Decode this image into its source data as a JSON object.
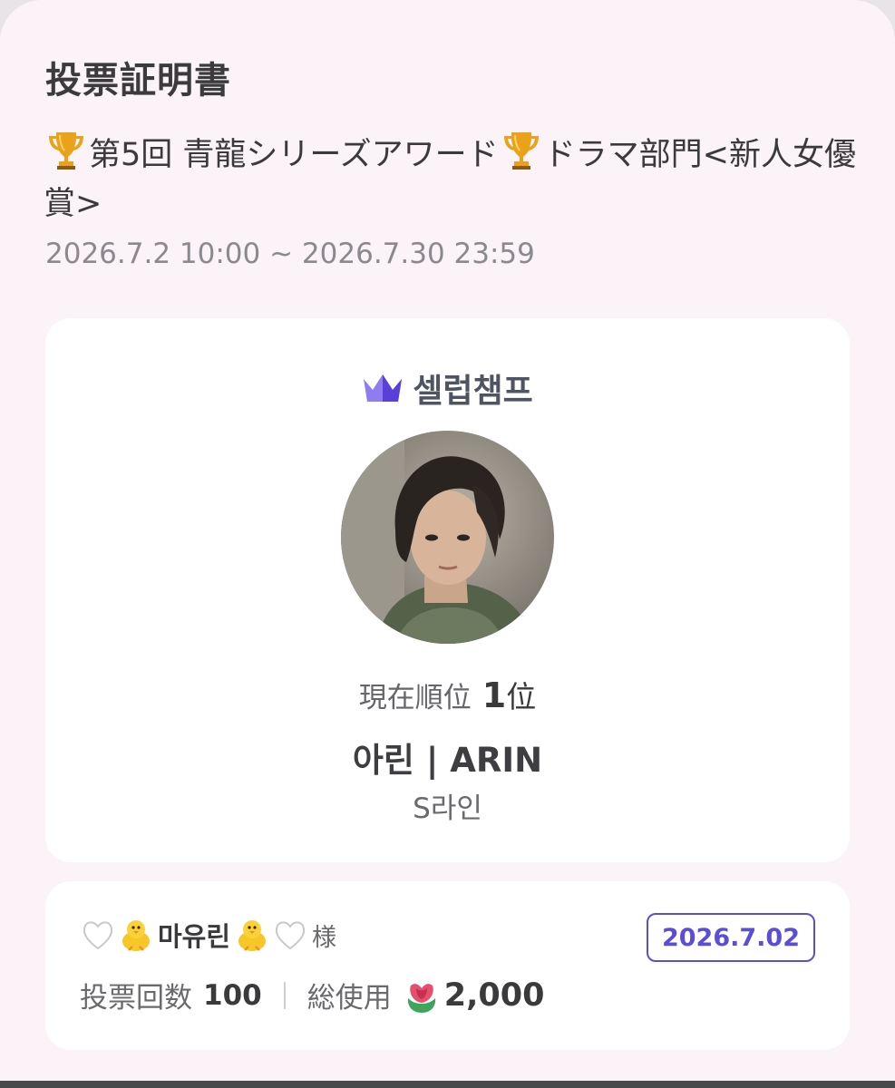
{
  "certificate": {
    "title": "投票証明書",
    "event_title_prefix": "第5回 青龍シリーズアワード",
    "event_title_suffix": "ドラマ部門<新人女優賞>",
    "period": "2026.7.2 10:00 ~ 2026.7.30 23:59"
  },
  "brand": {
    "name": "셀럽챔프",
    "icon": "crown-icon",
    "colors": {
      "crown_light": "#8f7cf0",
      "crown_dark": "#5b3fd9"
    }
  },
  "candidate": {
    "rank_label": "現在順位",
    "rank_value": "1",
    "rank_suffix": "位",
    "name": "아린 | ARIN",
    "line": "S라인"
  },
  "vote": {
    "voter_prefix_emoji": "white-heart-chick",
    "voter_name": "마유린",
    "honorific": "様",
    "date": "2026.7.02",
    "count_label": "投票回数",
    "count_value": "100",
    "total_label": "総使用",
    "total_icon": "flower-icon",
    "total_value": "2,000"
  },
  "colors": {
    "background": "#fbf3f8",
    "card": "#ffffff",
    "accent": "#5b4ed6"
  }
}
